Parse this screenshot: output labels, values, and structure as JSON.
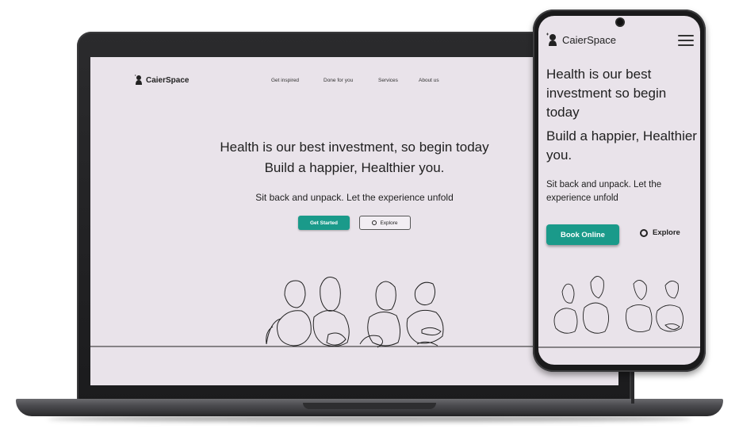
{
  "brand": {
    "name": "CaierSpace"
  },
  "desktop": {
    "nav": [
      {
        "label": "Get inspired"
      },
      {
        "label": "Done for you"
      },
      {
        "label": "Services"
      },
      {
        "label": "About us"
      }
    ],
    "headline_line1": "Health is our best investment, so begin today",
    "headline_line2": "Build a happier, Healthier you.",
    "subtext": "Sit back and unpack. Let the experience unfold",
    "primary_button": "Get Started",
    "secondary_button": "Explore"
  },
  "mobile": {
    "headline_line1": "Health is our best investment so begin today",
    "headline_line2": "Build a happier, Healthier you.",
    "subtext": "Sit back and unpack. Let the experience unfold",
    "primary_button": "Book Online",
    "secondary_button": "Explore"
  },
  "colors": {
    "accent": "#1a9a8a",
    "background": "#e9e3ea"
  },
  "icons": [
    "logo-icon",
    "hamburger-menu-icon",
    "circle-icon"
  ]
}
